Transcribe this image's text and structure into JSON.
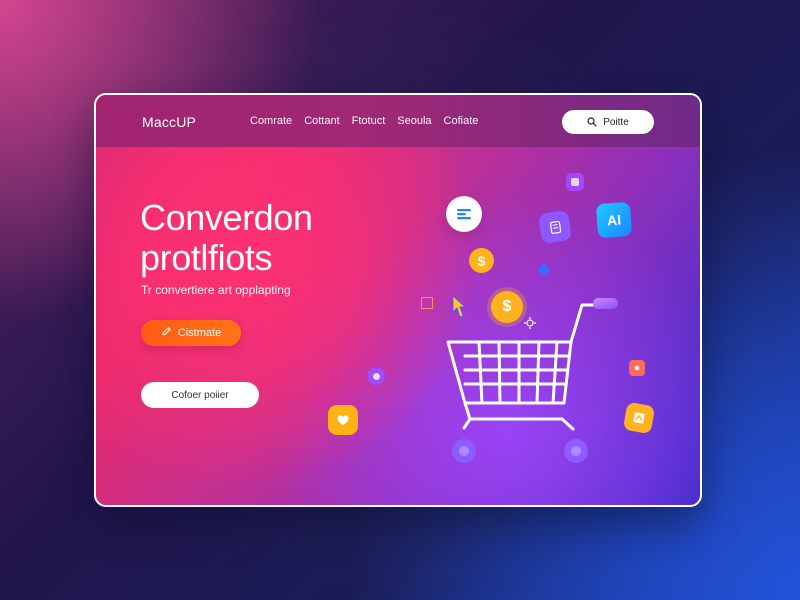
{
  "brand": {
    "name": "MaccUP"
  },
  "nav": {
    "items": [
      "Comrate",
      "Cottant",
      "Ftotuct",
      "Seoula",
      "Cofiate"
    ]
  },
  "search": {
    "label": "Poitte"
  },
  "hero": {
    "title_line_1": "Converdon",
    "title_line_2": "protlfiots",
    "subtitle": "Tr convertiere art opplapting"
  },
  "buttons": {
    "primary": "Cistmate",
    "secondary": "Cofoer poiier"
  },
  "floating_icons": {
    "ai_label": "AI",
    "dollar_label": "$"
  },
  "colors": {
    "accent_orange": "#ff5f17",
    "accent_pink": "#ff2f70",
    "accent_purple": "#8d5cff",
    "cart_color": "#ffffff"
  }
}
